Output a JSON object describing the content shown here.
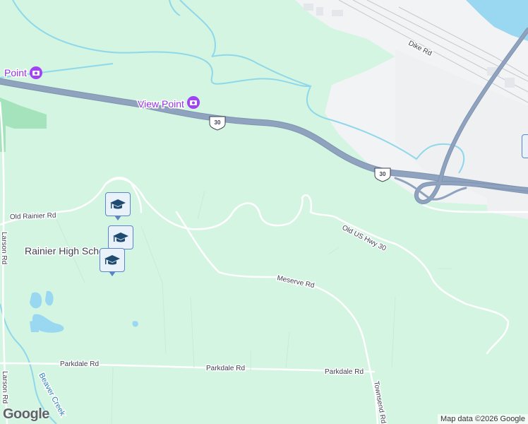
{
  "colors": {
    "land": "#d4f5e2",
    "urban": "#f1f3f4",
    "water": "#9ad7f0",
    "stream": "#8fd8ea",
    "highway": "#8fa3bf",
    "road": "#ffffff",
    "park": "#a5e3bd",
    "marker_border": "#5b86c5",
    "marker_fill": "#e9f1fb",
    "marker_icon": "#1e4b6f",
    "poi_text": "#9334e6"
  },
  "roads": {
    "dike": "Dike Rd",
    "old_rainier": "Old Rainier Rd",
    "larson_top": "Larson Rd",
    "larson_bottom": "Larson Rd",
    "old_us_hwy": "Old US Hwy 30",
    "meserve": "Meserve Rd",
    "parkdale_1": "Parkdale Rd",
    "parkdale_2": "Parkdale Rd",
    "parkdale_3": "Parkdale Rd",
    "townsend": "Townsend Rd"
  },
  "shields": {
    "us30_a": "30",
    "us30_b": "30"
  },
  "pois": {
    "view_point_1": "Point",
    "view_point_2": "View Point",
    "school": "Rainier High Scho"
  },
  "markers": [
    {
      "icon": "graduation-cap-icon"
    },
    {
      "icon": "graduation-cap-icon"
    },
    {
      "icon": "graduation-cap-icon"
    }
  ],
  "water": {
    "beaver_creek": "Beaver Creek"
  },
  "branding": {
    "logo": "Google",
    "attribution": "Map data ©2026 Google"
  }
}
